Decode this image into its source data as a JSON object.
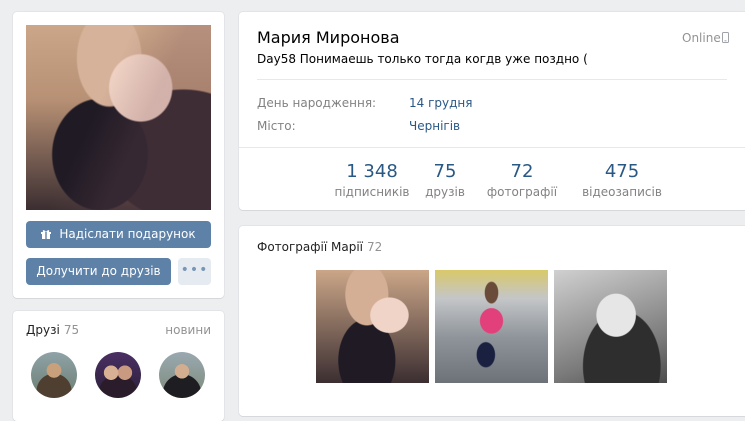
{
  "profile": {
    "name": "Мария Миронова",
    "status": "Day58 Понимаешь только тогда когдв уже поздно (",
    "online": "Online"
  },
  "buttons": {
    "gift": "Надіслати подарунок",
    "add_friend": "Долучити до друзів",
    "more": "•••"
  },
  "info": [
    {
      "label": "День народження:",
      "value": "14 грудня"
    },
    {
      "label": "Місто:",
      "value": "Чернігів"
    }
  ],
  "counters": [
    {
      "num": "1 348",
      "label": "підписників"
    },
    {
      "num": "75",
      "label": "друзів"
    },
    {
      "num": "72",
      "label": "фотографії"
    },
    {
      "num": "475",
      "label": "відеозаписів"
    }
  ],
  "friends": {
    "title": "Друзі",
    "count": "75",
    "news": "новини"
  },
  "photos": {
    "title": "Фотографії Марії",
    "count": "72"
  },
  "icons": {
    "gift": "gift-icon",
    "phone": "mobile-phone-icon"
  },
  "colors": {
    "accent": "#5e81a8",
    "link": "#2a5885",
    "background": "#edeef0"
  }
}
